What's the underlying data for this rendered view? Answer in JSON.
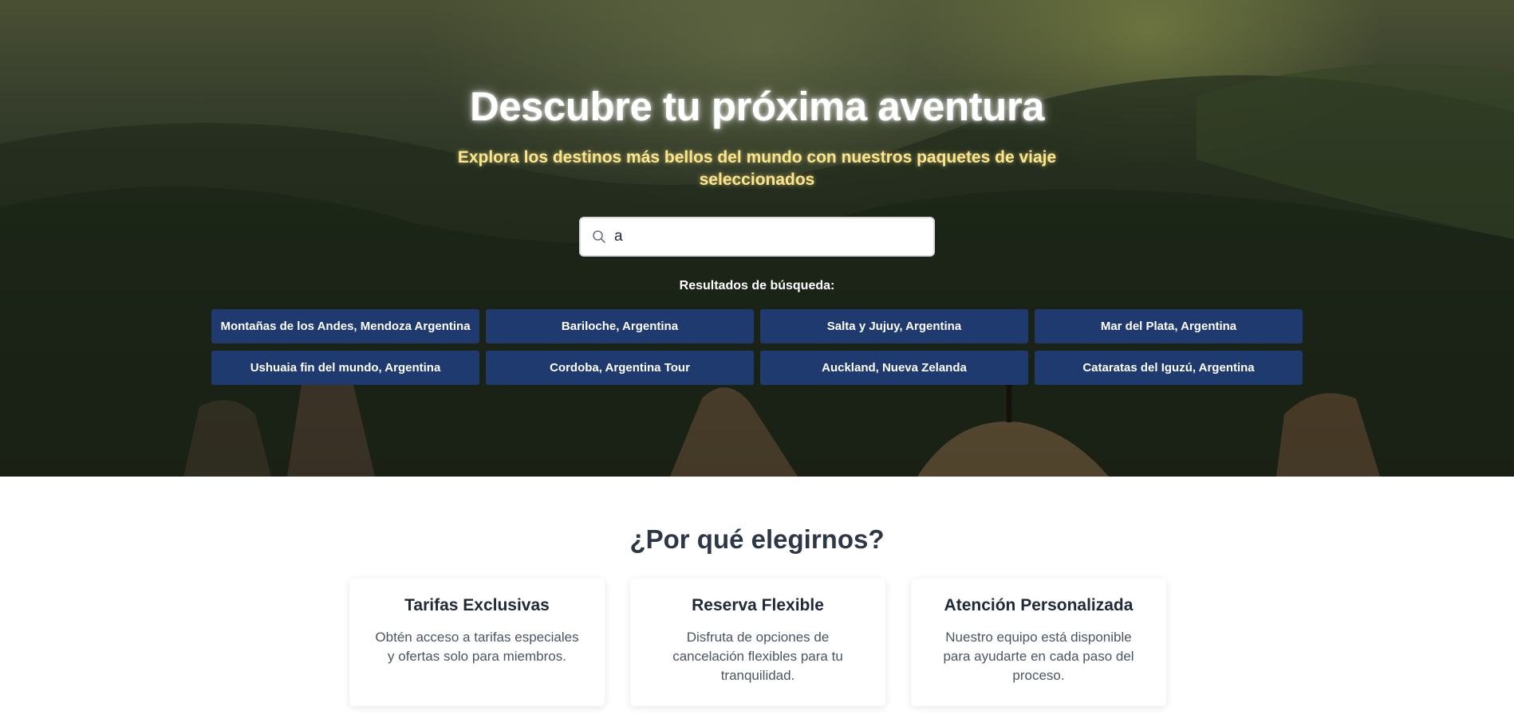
{
  "hero": {
    "title": "Descubre tu próxima aventura",
    "subtitle": "Explora los destinos más bellos del mundo con nuestros paquetes de viaje seleccionados"
  },
  "search": {
    "value": "a",
    "icon": "search-icon"
  },
  "results": {
    "label": "Resultados de búsqueda:",
    "items": [
      "Montañas de los Andes, Mendoza Argentina",
      "Bariloche, Argentina",
      "Salta y Jujuy, Argentina",
      "Mar del Plata, Argentina",
      "Ushuaia fin del mundo, Argentina",
      "Cordoba, Argentina Tour",
      "Auckland, Nueva Zelanda",
      "Cataratas del Iguzú, Argentina"
    ]
  },
  "why": {
    "title": "¿Por qué elegirnos?",
    "cards": [
      {
        "title": "Tarifas Exclusivas",
        "text": "Obtén acceso a tarifas especiales y ofertas solo para miembros."
      },
      {
        "title": "Reserva Flexible",
        "text": "Disfruta de opciones de cancelación flexibles para tu tranquilidad."
      },
      {
        "title": "Atención Personalizada",
        "text": "Nuestro equipo está disponible para ayudarte en cada paso del proceso."
      }
    ]
  },
  "colors": {
    "result_button": "#1e3a6e",
    "subtitle": "#fde68a",
    "heading": "#2d3748"
  }
}
